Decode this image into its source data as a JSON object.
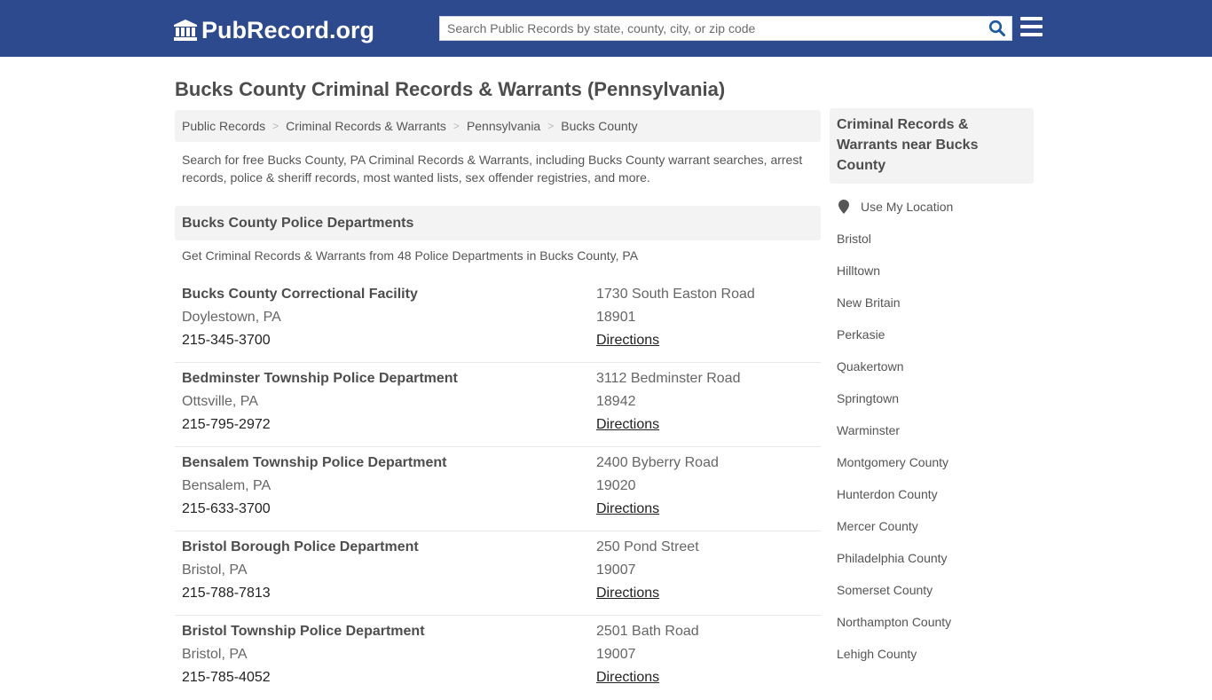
{
  "header": {
    "logo_text": "PubRecord.org",
    "logo_icon": "courthouse-icon",
    "search_placeholder": "Search Public Records by state, county, city, or zip code",
    "search_value": "",
    "search_icon": "search-icon",
    "menu_icon": "hamburger-menu-icon",
    "brand_color": "#2e4a8f",
    "accent_color": "#1a5aa6"
  },
  "page": {
    "title": "Bucks County Criminal Records & Warrants (Pennsylvania)",
    "breadcrumb": [
      {
        "label": "Public Records"
      },
      {
        "label": "Criminal Records & Warrants"
      },
      {
        "label": "Pennsylvania"
      },
      {
        "label": "Bucks County"
      }
    ],
    "breadcrumb_separator": ">",
    "intro": "Search for free Bucks County, PA Criminal Records & Warrants, including Bucks County warrant searches, arrest records, police & sheriff records, most wanted lists, sex offender registries, and more."
  },
  "section": {
    "title": "Bucks County Police Departments",
    "subtitle": "Get Criminal Records & Warrants from 48 Police Departments in Bucks County, PA",
    "entries": [
      {
        "name": "Bucks County Correctional Facility",
        "city": "Doylestown, PA",
        "phone": "215-345-3700",
        "address": "1730 South Easton Road",
        "zip": "18901",
        "directions": "Directions"
      },
      {
        "name": "Bedminster Township Police Department",
        "city": "Ottsville, PA",
        "phone": "215-795-2972",
        "address": "3112 Bedminster Road",
        "zip": "18942",
        "directions": "Directions"
      },
      {
        "name": "Bensalem Township Police Department",
        "city": "Bensalem, PA",
        "phone": "215-633-3700",
        "address": "2400 Byberry Road",
        "zip": "19020",
        "directions": "Directions"
      },
      {
        "name": "Bristol Borough Police Department",
        "city": "Bristol, PA",
        "phone": "215-788-7813",
        "address": "250 Pond Street",
        "zip": "19007",
        "directions": "Directions"
      },
      {
        "name": "Bristol Township Police Department",
        "city": "Bristol, PA",
        "phone": "215-785-4052",
        "address": "2501 Bath Road",
        "zip": "19007",
        "directions": "Directions"
      }
    ]
  },
  "sidebar": {
    "title": "Criminal Records & Warrants near Bucks County",
    "location_label": "Use My Location",
    "location_icon": "map-marker-icon",
    "items": [
      {
        "label": "Bristol"
      },
      {
        "label": "Hilltown"
      },
      {
        "label": "New Britain"
      },
      {
        "label": "Perkasie"
      },
      {
        "label": "Quakertown"
      },
      {
        "label": "Springtown"
      },
      {
        "label": "Warminster"
      },
      {
        "label": "Montgomery County"
      },
      {
        "label": "Hunterdon County"
      },
      {
        "label": "Mercer County"
      },
      {
        "label": "Philadelphia County"
      },
      {
        "label": "Somerset County"
      },
      {
        "label": "Northampton County"
      },
      {
        "label": "Lehigh County"
      }
    ]
  }
}
